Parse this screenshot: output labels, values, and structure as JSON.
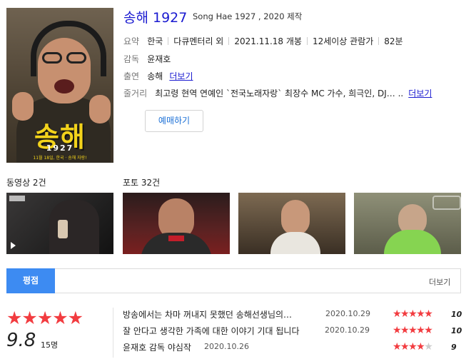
{
  "movie": {
    "title": "송해 1927",
    "subtitle": "Song Hae 1927 , 2020 제작",
    "summary": {
      "label": "요약",
      "country": "한국",
      "genre": "다큐멘터리 외",
      "release": "2021.11.18 개봉",
      "rating": "12세이상 관람가",
      "runtime": "82분"
    },
    "director": {
      "label": "감독",
      "name": "윤재호"
    },
    "cast": {
      "label": "출연",
      "name": "송해",
      "more": "더보기"
    },
    "plot": {
      "label": "줄거리",
      "text": "최고령 현역 연예인 `전국노래자랑` 최장수 MC 가수, 희극인, DJ… ..",
      "more": "더보기"
    },
    "book_button": "예매하기",
    "poster": {
      "title": "송해",
      "year": "1927",
      "date_line": "11월 18일, 한국 · 송해 자랑!"
    }
  },
  "media": {
    "videos_label": "동영상 2건",
    "photos_label": "포토 32건"
  },
  "reviews": {
    "tab_label": "평점",
    "more": "더보기",
    "average": "9.8",
    "count": "15명",
    "accent": "#f23c40",
    "items": [
      {
        "text": "방송에서는 차마 꺼내지 못했던 송해선생님의…",
        "date": "2020.10.29",
        "score": "10",
        "stars": 5
      },
      {
        "text": "잘 안다고 생각한 가족에 대한 이야기 기대 됩니다",
        "date": "2020.10.29",
        "score": "10",
        "stars": 5
      },
      {
        "text": "윤재호 감독 야심작",
        "date": "2020.10.26",
        "score": "9",
        "stars": 4.5
      }
    ]
  }
}
